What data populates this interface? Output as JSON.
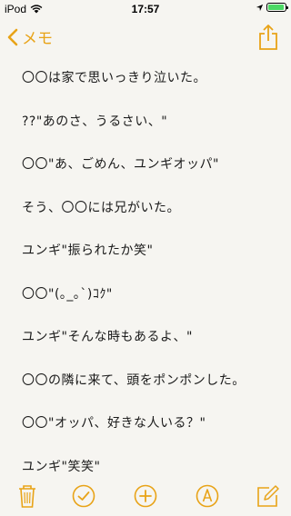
{
  "status_bar": {
    "carrier": "iPod",
    "time": "17:57"
  },
  "nav": {
    "back_label": "メモ"
  },
  "note": {
    "lines": [
      "〇〇は家で思いっきり泣いた。",
      "??\"あのさ、うるさい、\"",
      "〇〇\"あ、ごめん、ユンギオッパ\"",
      "そう、〇〇には兄がいた。",
      "ユンギ\"振られたか笑\"",
      "〇〇\"(｡_｡`)ｺｸ\"",
      "ユンギ\"そんな時もあるよ、\"",
      "〇〇の隣に来て、頭をポンポンした。",
      "〇〇\"オッパ、好きな人いる？\"",
      "ユンギ\"笑笑\""
    ]
  },
  "colors": {
    "accent": "#e8a317",
    "background": "#f6f5f1",
    "battery": "#4cd964"
  },
  "icons": {
    "toolbar": [
      "trash-icon",
      "checkmark-icon",
      "add-icon",
      "sketch-icon",
      "compose-icon"
    ]
  }
}
